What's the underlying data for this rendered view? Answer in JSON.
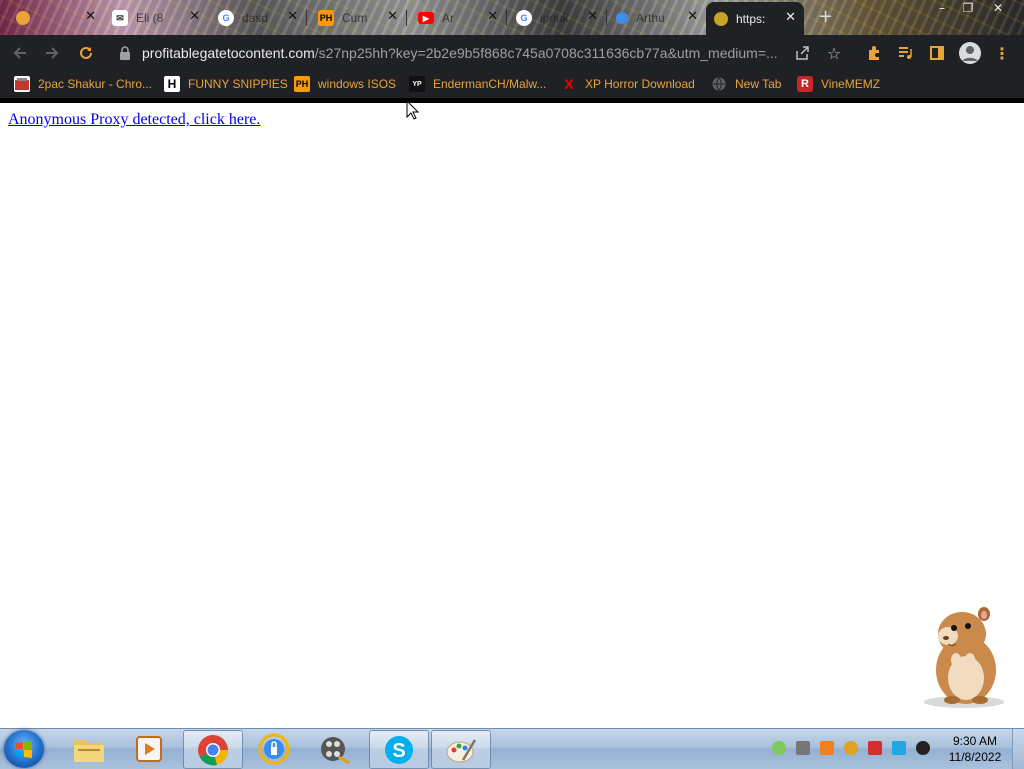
{
  "tabs": [
    {
      "title": "",
      "favicon": "chrome-icon",
      "color": "#e8a33b"
    },
    {
      "title": "Eli (8",
      "favicon": "mail-icon",
      "color": "#ffffff"
    },
    {
      "title": "dasd",
      "favicon": "google-icon",
      "color": "#ffffff"
    },
    {
      "title": "Cum",
      "favicon": "ph-icon",
      "fav_text": "PH",
      "color": "#ff9900"
    },
    {
      "title": "Ar",
      "favicon": "youtube-icon",
      "color": "#ff0000"
    },
    {
      "title": "ipnuk",
      "favicon": "google-icon",
      "color": "#ffffff"
    },
    {
      "title": "Arthu",
      "favicon": "globe-icon",
      "color": "#3b8eea"
    },
    {
      "title": "https:",
      "favicon": "site-icon",
      "color": "#c9a227",
      "active": true
    }
  ],
  "toolbar": {
    "url_host": "profitablegatetocontent.com",
    "url_path": "/s27np25hh?key=2b2e9b5f868c745a0708c311636cb77a&utm_medium=..."
  },
  "bookmarks": [
    {
      "label": "2pac Shakur - Chro...",
      "icon": "cassette-icon"
    },
    {
      "label": "FUNNY SNIPPIES",
      "icon": "h-icon",
      "icon_text": "H"
    },
    {
      "label": "windows ISOS",
      "icon": "ph-icon",
      "icon_text": "PH"
    },
    {
      "label": "EndermanCH/Malw...",
      "icon": "yp-icon",
      "icon_text": "YP"
    },
    {
      "label": "XP Horror Download",
      "icon": "x-icon",
      "icon_text": "X"
    },
    {
      "label": "New Tab",
      "icon": "globe-icon"
    },
    {
      "label": "VineMEMZ",
      "icon": "r-icon",
      "icon_text": "R"
    }
  ],
  "page": {
    "link_text": "Anonymous Proxy detected, click here."
  },
  "taskbar": {
    "apps": [
      "file-explorer-icon",
      "media-player-icon",
      "chrome-icon",
      "vpn-icon",
      "video-editor-icon",
      "skype-icon",
      "paint-icon"
    ],
    "time": "9:30 AM",
    "date": "11/8/2022"
  }
}
